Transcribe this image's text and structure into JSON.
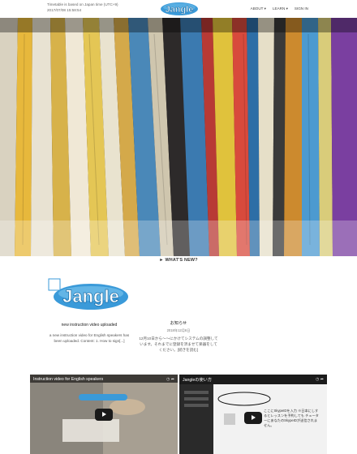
{
  "header": {
    "timezone_note": "Timetable is based on Japan time (UTC+9)",
    "datetime": "2017/07/08 15:58:54",
    "brand": "Jangle",
    "nav": [
      {
        "label": "ABOUT ▾"
      },
      {
        "label": "LEARN ▾"
      },
      {
        "label": "SIGN IN"
      }
    ]
  },
  "whats_new": {
    "label": "► WHAT'S NEW?"
  },
  "news": [
    {
      "title": "new instruction video uploaded",
      "body": "a new instruction video for English speakers has been uploaded. Content: 1. How to sign[...]"
    },
    {
      "title": "お知らせ",
      "date": "2018年12月6日",
      "body": "12月10日から〜〜にかけてシステムの調整しています。それまでに登録を済ませて楽器をしてください。[続きを読む]"
    }
  ],
  "videos": [
    {
      "title": "Instruction video for English speakers"
    },
    {
      "title": "Jangleの使い方",
      "note": "ここにSkypeIDを入力 ※日本にしするとレッスンを予約しても チューターにあなたのSkypeIDが送信されません。"
    }
  ],
  "colors": {
    "brand_blue": "#3a9ad9"
  }
}
